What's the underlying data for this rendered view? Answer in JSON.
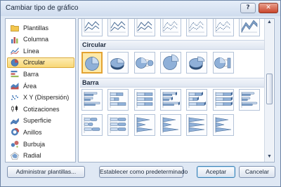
{
  "window": {
    "title": "Cambiar tipo de gráfico",
    "help_label": "?",
    "close_label": "✕"
  },
  "sidebar": {
    "items": [
      {
        "label": "Plantillas",
        "icon": "folder-icon",
        "selected": false
      },
      {
        "label": "Columna",
        "icon": "column-chart-icon",
        "selected": false
      },
      {
        "label": "Línea",
        "icon": "line-chart-icon",
        "selected": false
      },
      {
        "label": "Circular",
        "icon": "pie-chart-icon",
        "selected": true
      },
      {
        "label": "Barra",
        "icon": "bar-chart-icon",
        "selected": false
      },
      {
        "label": "Área",
        "icon": "area-chart-icon",
        "selected": false
      },
      {
        "label": "X Y (Dispersión)",
        "icon": "scatter-chart-icon",
        "selected": false
      },
      {
        "label": "Cotizaciones",
        "icon": "stock-chart-icon",
        "selected": false
      },
      {
        "label": "Superficie",
        "icon": "surface-chart-icon",
        "selected": false
      },
      {
        "label": "Anillos",
        "icon": "doughnut-chart-icon",
        "selected": false
      },
      {
        "label": "Burbuja",
        "icon": "bubble-chart-icon",
        "selected": false
      },
      {
        "label": "Radial",
        "icon": "radar-chart-icon",
        "selected": false
      }
    ]
  },
  "gallery": {
    "line_row": [
      "line",
      "line-stacked",
      "line-100",
      "line-markers",
      "line-markers-stacked",
      "line-markers-100",
      "line-3d"
    ],
    "circular": {
      "header": "Circular",
      "items": [
        "pie",
        "pie-3d",
        "pie-of-pie",
        "pie-exploded",
        "pie-exploded-3d",
        "bar-of-pie"
      ],
      "selected_index": 0
    },
    "barra": {
      "header": "Barra",
      "items": [
        "bar-clustered",
        "bar-stacked",
        "bar-100",
        "bar-3d-clustered",
        "bar-3d-stacked",
        "bar-3d-100",
        "bar-cylinder-clustered",
        "bar-cylinder-stacked",
        "bar-cylinder-100",
        "bar-cone-clustered",
        "bar-cone-stacked",
        "bar-cone-100",
        "bar-pyramid-clustered"
      ]
    }
  },
  "buttons": {
    "manage_templates": "Administrar plantillas...",
    "set_default": "Establecer como predeterminado",
    "accept": "Aceptar",
    "cancel": "Cancelar"
  },
  "colors": {
    "selection_fill": "#fde9a8",
    "selection_border": "#e3a332",
    "chart_blue": "#4f81bd"
  }
}
